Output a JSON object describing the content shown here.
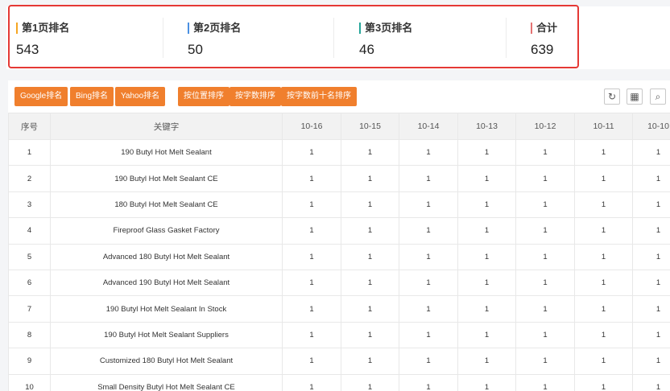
{
  "stats": [
    {
      "label": "第1页排名",
      "value": "543",
      "color": "#f5a623"
    },
    {
      "label": "第2页排名",
      "value": "50",
      "color": "#4a90e2"
    },
    {
      "label": "第3页排名",
      "value": "46",
      "color": "#26a69a"
    },
    {
      "label": "合计",
      "value": "639",
      "color": "#e57373"
    }
  ],
  "toolbar": {
    "google": "Google排名",
    "bing": "Bing排名",
    "yahoo": "Yahoo排名",
    "sort_position": "按位置排序",
    "sort_count": "按字数排序",
    "sort_top10": "按字数前十名排序",
    "refresh_icon": "↻",
    "columns_icon": "▦",
    "search_icon": "⌕"
  },
  "table": {
    "headers": [
      "序号",
      "关键字",
      "10-16",
      "10-15",
      "10-14",
      "10-13",
      "10-12",
      "10-11",
      "10-10"
    ],
    "rows": [
      [
        "1",
        "190 Butyl Hot Melt Sealant",
        "1",
        "1",
        "1",
        "1",
        "1",
        "1",
        "1"
      ],
      [
        "2",
        "190 Butyl Hot Melt Sealant CE",
        "1",
        "1",
        "1",
        "1",
        "1",
        "1",
        "1"
      ],
      [
        "3",
        "180 Butyl Hot Melt Sealant CE",
        "1",
        "1",
        "1",
        "1",
        "1",
        "1",
        "1"
      ],
      [
        "4",
        "Fireproof Glass Gasket Factory",
        "1",
        "1",
        "1",
        "1",
        "1",
        "1",
        "1"
      ],
      [
        "5",
        "Advanced 180 Butyl Hot Melt Sealant",
        "1",
        "1",
        "1",
        "1",
        "1",
        "1",
        "1"
      ],
      [
        "6",
        "Advanced 190 Butyl Hot Melt Sealant",
        "1",
        "1",
        "1",
        "1",
        "1",
        "1",
        "1"
      ],
      [
        "7",
        "190 Butyl Hot Melt Sealant In Stock",
        "1",
        "1",
        "1",
        "1",
        "1",
        "1",
        "1"
      ],
      [
        "8",
        "190 Butyl Hot Melt Sealant Suppliers",
        "1",
        "1",
        "1",
        "1",
        "1",
        "1",
        "1"
      ],
      [
        "9",
        "Customized 180 Butyl Hot Melt Sealant",
        "1",
        "1",
        "1",
        "1",
        "1",
        "1",
        "1"
      ],
      [
        "10",
        "Small Density Butyl Hot Melt Sealant CE",
        "1",
        "1",
        "1",
        "1",
        "1",
        "1",
        "1"
      ]
    ]
  }
}
